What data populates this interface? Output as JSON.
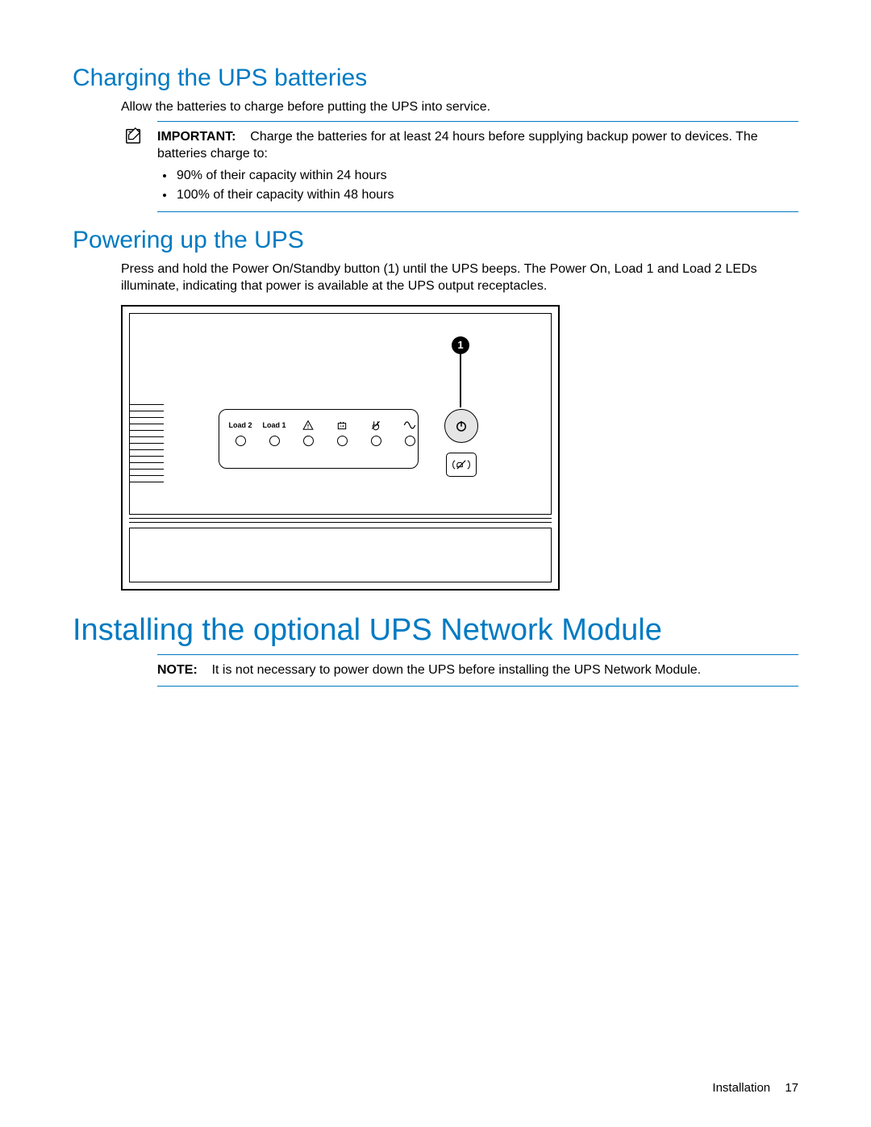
{
  "section1": {
    "heading": "Charging the UPS batteries",
    "intro": "Allow the batteries to charge before putting the UPS into service.",
    "important_label": "IMPORTANT:",
    "important_text": "Charge the batteries for at least 24 hours before supplying backup power to devices. The batteries charge to:",
    "bullets": [
      "90% of their capacity within 24 hours",
      "100% of their capacity within 48 hours"
    ]
  },
  "section2": {
    "heading": "Powering up the UPS",
    "text": "Press and hold the Power On/Standby button (1) until the UPS beeps. The Power On, Load 1 and Load 2 LEDs illuminate, indicating that power is available at the UPS output receptacles."
  },
  "figure": {
    "callout": "1",
    "leds": {
      "load2": "Load 2",
      "load1": "Load 1"
    }
  },
  "section3": {
    "heading": "Installing the optional UPS Network Module",
    "note_label": "NOTE:",
    "note_text": "It is not necessary to power down the UPS before installing the UPS Network Module."
  },
  "footer": {
    "section": "Installation",
    "page": "17"
  }
}
